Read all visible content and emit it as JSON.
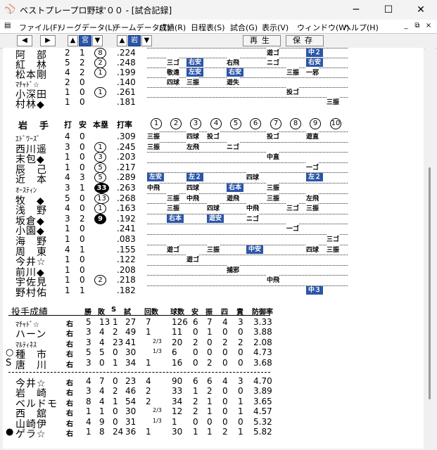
{
  "window": {
    "title": "ベストプレープロ野球'００ - [試合記録]",
    "minimize": "─",
    "maximize": "☐",
    "close": "✕"
  },
  "menu": {
    "items": [
      "ファイル(F)",
      "リーグデータ(L)",
      "チームデータ(T)",
      "成績(R)",
      "日程表(S)",
      "試合(G)",
      "表示(V)",
      "ウィンドウ(W)",
      "ヘルプ(H)"
    ],
    "mdi": [
      "_",
      "⧉",
      "×"
    ]
  },
  "toolbar": {
    "left_arrow": "◀",
    "right_arrow": "▶",
    "up1": "▲",
    "team1": "宮",
    "down1": "▼",
    "up2": "▲",
    "team2": "岩",
    "down2": "▼",
    "replay": "再生",
    "save": "保存"
  },
  "top_batters": [
    {
      "mark": "",
      "name": "阿　部",
      "ab": "2",
      "h": "1",
      "hr": "8",
      "hr_black": false,
      "avg": ".224",
      "results": [
        {
          "pos": 6,
          "t": "遊ゴ",
          "hit": false
        },
        {
          "pos": 8,
          "t": "中２",
          "hit": true
        }
      ]
    },
    {
      "mark": "",
      "name": "紅　林",
      "ab": "5",
      "h": "2",
      "hr": "2",
      "hr_black": false,
      "avg": ".248",
      "results": [
        {
          "pos": 1,
          "t": "三ゴ",
          "hit": false
        },
        {
          "pos": 2,
          "t": "右安",
          "hit": true
        },
        {
          "pos": 4,
          "t": "右飛",
          "hit": false
        },
        {
          "pos": 6,
          "t": "ニゴ",
          "hit": false
        },
        {
          "pos": 8,
          "t": "右安",
          "hit": true
        }
      ]
    },
    {
      "mark": "",
      "name": "松本剛",
      "ab": "4",
      "h": "2",
      "hr": "1",
      "hr_black": false,
      "avg": ".199",
      "results": [
        {
          "pos": 1,
          "t": "敬遠",
          "hit": false
        },
        {
          "pos": 2,
          "t": "左安",
          "hit": true
        },
        {
          "pos": 4,
          "t": "右安",
          "hit": true
        },
        {
          "pos": 7,
          "t": "三振",
          "hit": false
        },
        {
          "pos": 8,
          "t": "一邪",
          "hit": false
        }
      ]
    },
    {
      "mark": "",
      "name": "ﾏﾁｬﾄﾞ☆",
      "small": true,
      "ab": "2",
      "h": "0",
      "hr": "",
      "hr_black": false,
      "avg": ".140",
      "results": [
        {
          "pos": 1,
          "t": "四球",
          "hit": false
        },
        {
          "pos": 2,
          "t": "三振",
          "hit": false
        },
        {
          "pos": 4,
          "t": "遊失",
          "hit": false
        }
      ]
    },
    {
      "mark": "",
      "name": "小深田",
      "ab": "1",
      "h": "0",
      "hr": "1",
      "hr_black": false,
      "avg": ".261",
      "results": [
        {
          "pos": 7,
          "t": "投ゴ",
          "hit": false
        }
      ]
    },
    {
      "mark": "",
      "name": "村林◆",
      "ab": "1",
      "h": "0",
      "hr": "",
      "hr_black": false,
      "avg": ".181",
      "results": [
        {
          "pos": 9,
          "t": "三振",
          "hit": false
        }
      ]
    }
  ],
  "iwate": {
    "team_label": "岩　手",
    "headers": {
      "ab": "打",
      "h": "安",
      "hr": "本塁",
      "avg": "打率"
    },
    "innings": [
      "1",
      "2",
      "3",
      "4",
      "5",
      "6",
      "7",
      "8",
      "9",
      "10"
    ],
    "batters": [
      {
        "mark": "",
        "name": "ｴﾄﾞﾜｰｽﾞ",
        "small": true,
        "ab": "4",
        "h": "0",
        "hr": "",
        "hr_black": false,
        "avg": ".309",
        "results": [
          {
            "pos": 0,
            "t": "三振",
            "hit": false
          },
          {
            "pos": 2,
            "t": "四球",
            "hit": false
          },
          {
            "pos": 3,
            "t": "投ゴ",
            "hit": false
          },
          {
            "pos": 6,
            "t": "投ゴ",
            "hit": false
          },
          {
            "pos": 8,
            "t": "遊直",
            "hit": false
          }
        ]
      },
      {
        "mark": "",
        "name": "西川遥",
        "ab": "3",
        "h": "0",
        "hr": "1",
        "hr_black": false,
        "avg": ".245",
        "results": [
          {
            "pos": 0,
            "t": "三振",
            "hit": false
          },
          {
            "pos": 2,
            "t": "左飛",
            "hit": false
          },
          {
            "pos": 4,
            "t": "ニゴ",
            "hit": false
          }
        ]
      },
      {
        "mark": "",
        "name": "末包◆",
        "ab": "1",
        "h": "0",
        "hr": "3",
        "hr_black": false,
        "avg": ".203",
        "results": [
          {
            "pos": 6,
            "t": "中直",
            "hit": false
          }
        ]
      },
      {
        "mark": "",
        "name": "辰　己",
        "ab": "1",
        "h": "0",
        "hr": "5",
        "hr_black": false,
        "avg": ".217",
        "results": [
          {
            "pos": 8,
            "t": "一ゴ",
            "hit": false
          }
        ]
      },
      {
        "mark": "",
        "name": "近　本",
        "ab": "4",
        "h": "3",
        "hr": "5",
        "hr_black": false,
        "avg": ".289",
        "results": [
          {
            "pos": 0,
            "t": "左安",
            "hit": true
          },
          {
            "pos": 2,
            "t": "左２",
            "hit": true
          },
          {
            "pos": 5,
            "t": "四球",
            "hit": false
          },
          {
            "pos": 8,
            "t": "左２",
            "hit": true
          }
        ]
      },
      {
        "mark": "",
        "name": "ｵｰｽﾃｨﾝ",
        "small": true,
        "ab": "3",
        "h": "1",
        "hr": "33",
        "hr_black": true,
        "avg": ".263",
        "results": [
          {
            "pos": 0,
            "t": "中飛",
            "hit": false
          },
          {
            "pos": 2,
            "t": "四球",
            "hit": false
          },
          {
            "pos": 4,
            "t": "右本",
            "hit": true
          },
          {
            "pos": 6,
            "t": "三振",
            "hit": false
          }
        ]
      },
      {
        "mark": "",
        "name": "牧　◆",
        "ab": "5",
        "h": "0",
        "hr": "13",
        "hr_black": false,
        "avg": ".268",
        "results": [
          {
            "pos": 1,
            "t": "三振",
            "hit": false
          },
          {
            "pos": 2,
            "t": "中飛",
            "hit": false
          },
          {
            "pos": 4,
            "t": "遊飛",
            "hit": false
          },
          {
            "pos": 6,
            "t": "三振",
            "hit": false
          },
          {
            "pos": 8,
            "t": "左飛",
            "hit": false
          }
        ]
      },
      {
        "mark": "",
        "name": "浅　野",
        "ab": "4",
        "h": "0",
        "hr": "1",
        "hr_black": false,
        "avg": ".163",
        "results": [
          {
            "pos": 1,
            "t": "三振",
            "hit": false
          },
          {
            "pos": 3,
            "t": "四球",
            "hit": false
          },
          {
            "pos": 5,
            "t": "中飛",
            "hit": false
          },
          {
            "pos": 7,
            "t": "三ゴ",
            "hit": false
          },
          {
            "pos": 8,
            "t": "三振",
            "hit": false
          }
        ]
      },
      {
        "mark": "",
        "name": "坂倉◆",
        "ab": "3",
        "h": "2",
        "hr": "9",
        "hr_black": true,
        "avg": ".192",
        "results": [
          {
            "pos": 1,
            "t": "右本",
            "hit": true
          },
          {
            "pos": 3,
            "t": "遊安",
            "hit": true
          },
          {
            "pos": 5,
            "t": "ニゴ",
            "hit": false
          }
        ]
      },
      {
        "mark": "",
        "name": "小園◆",
        "ab": "1",
        "h": "0",
        "hr": "",
        "hr_black": false,
        "avg": ".241",
        "results": [
          {
            "pos": 7,
            "t": "一ゴ",
            "hit": false
          }
        ]
      },
      {
        "mark": "",
        "name": "海　野",
        "ab": "1",
        "h": "0",
        "hr": "",
        "hr_black": false,
        "avg": ".083",
        "results": [
          {
            "pos": 9,
            "t": "三ゴ",
            "hit": false
          }
        ]
      },
      {
        "mark": "",
        "name": "周　東",
        "ab": "4",
        "h": "1",
        "hr": "",
        "hr_black": false,
        "avg": ".155",
        "results": [
          {
            "pos": 1,
            "t": "遊ゴ",
            "hit": false
          },
          {
            "pos": 3,
            "t": "三振",
            "hit": false
          },
          {
            "pos": 5,
            "t": "中安",
            "hit": true
          },
          {
            "pos": 8,
            "t": "四球",
            "hit": false
          },
          {
            "pos": 9,
            "t": "三振",
            "hit": false
          }
        ]
      },
      {
        "mark": "",
        "name": "今井☆",
        "ab": "1",
        "h": "0",
        "hr": "",
        "hr_black": false,
        "avg": ".122",
        "results": [
          {
            "pos": 2,
            "t": "遊ゴ",
            "hit": false
          }
        ]
      },
      {
        "mark": "",
        "name": "前川◆",
        "ab": "1",
        "h": "0",
        "hr": "",
        "hr_black": false,
        "avg": ".208",
        "results": [
          {
            "pos": 4,
            "t": "捕邪",
            "hit": false
          }
        ]
      },
      {
        "mark": "",
        "name": "宇佐見",
        "ab": "1",
        "h": "0",
        "hr": "2",
        "hr_black": false,
        "avg": ".218",
        "results": [
          {
            "pos": 6,
            "t": "中飛",
            "hit": false
          }
        ]
      },
      {
        "mark": "",
        "name": "野村佑",
        "ab": "1",
        "h": "1",
        "hr": "",
        "hr_black": false,
        "avg": ".182",
        "results": [
          {
            "pos": 8,
            "t": "中３",
            "hit": true
          }
        ]
      }
    ]
  },
  "pitching": {
    "title": "投手成績",
    "headers": [
      "勝",
      "敗",
      "S",
      "試",
      "回数",
      "球数",
      "安",
      "振",
      "四",
      "責",
      "防御率"
    ],
    "group1": [
      {
        "mark": "",
        "name": "ﾏﾁｬﾄﾞ☆",
        "small": true,
        "hand": "右",
        "w": "5",
        "l": "13",
        "s": "1",
        "g": "27",
        "ip": "7",
        "frac": "",
        "np": "126",
        "h": "6",
        "k": "7",
        "bb": "4",
        "er": "3",
        "era": "3.33"
      },
      {
        "mark": "",
        "name": "ハーン",
        "hand": "右",
        "w": "3",
        "l": "4",
        "s": "2",
        "g": "49",
        "ip": "1",
        "frac": "",
        "np": "11",
        "h": "0",
        "k": "1",
        "bb": "0",
        "er": "0",
        "era": "3.88"
      },
      {
        "mark": "",
        "name": "ﾏﾙﾃｨﾈｽ",
        "small": true,
        "hand": "右",
        "w": "3",
        "l": "4",
        "s": "23",
        "g": "41",
        "ip": "",
        "frac": "2/3",
        "np": "20",
        "h": "2",
        "k": "0",
        "bb": "2",
        "er": "2",
        "era": "2.08"
      },
      {
        "mark": "○",
        "name": "種　市",
        "hand": "右",
        "w": "5",
        "l": "5",
        "s": "0",
        "g": "30",
        "ip": "",
        "frac": "1/3",
        "np": "6",
        "h": "0",
        "k": "0",
        "bb": "0",
        "er": "0",
        "era": "4.73"
      },
      {
        "mark": "S",
        "name": "唐　川",
        "hand": "右",
        "w": "3",
        "l": "0",
        "s": "1",
        "g": "34",
        "ip": "1",
        "frac": "",
        "np": "16",
        "h": "0",
        "k": "2",
        "bb": "0",
        "er": "0",
        "era": "3.68"
      }
    ],
    "group2": [
      {
        "mark": "",
        "name": "今井☆",
        "hand": "右",
        "w": "4",
        "l": "7",
        "s": "0",
        "g": "23",
        "ip": "4",
        "frac": "",
        "np": "90",
        "h": "6",
        "k": "6",
        "bb": "4",
        "er": "3",
        "era": "4.70"
      },
      {
        "mark": "",
        "name": "岩　崎",
        "hand": "右",
        "w": "3",
        "l": "4",
        "s": "2",
        "g": "46",
        "ip": "2",
        "frac": "",
        "np": "33",
        "h": "1",
        "k": "2",
        "bb": "0",
        "er": "0",
        "era": "3.89"
      },
      {
        "mark": "",
        "name": "ベルドモ",
        "hand": "右",
        "w": "8",
        "l": "4",
        "s": "1",
        "g": "54",
        "ip": "2",
        "frac": "",
        "np": "34",
        "h": "2",
        "k": "1",
        "bb": "0",
        "er": "1",
        "era": "3.65"
      },
      {
        "mark": "",
        "name": "西　舘",
        "hand": "右",
        "w": "1",
        "l": "1",
        "s": "0",
        "g": "30",
        "ip": "",
        "frac": "2/3",
        "np": "12",
        "h": "2",
        "k": "1",
        "bb": "0",
        "er": "1",
        "era": "4.57"
      },
      {
        "mark": "",
        "name": "山崎伊",
        "hand": "右",
        "w": "4",
        "l": "9",
        "s": "0",
        "g": "31",
        "ip": "",
        "frac": "1/3",
        "np": "1",
        "h": "0",
        "k": "0",
        "bb": "0",
        "er": "0",
        "era": "5.32"
      },
      {
        "mark": "●",
        "name": "ゲラ☆",
        "hand": "右",
        "w": "1",
        "l": "8",
        "s": "24",
        "g": "36",
        "ip": "1",
        "frac": "",
        "np": "30",
        "h": "1",
        "k": "1",
        "bb": "2",
        "er": "1",
        "era": "5.82"
      }
    ]
  }
}
